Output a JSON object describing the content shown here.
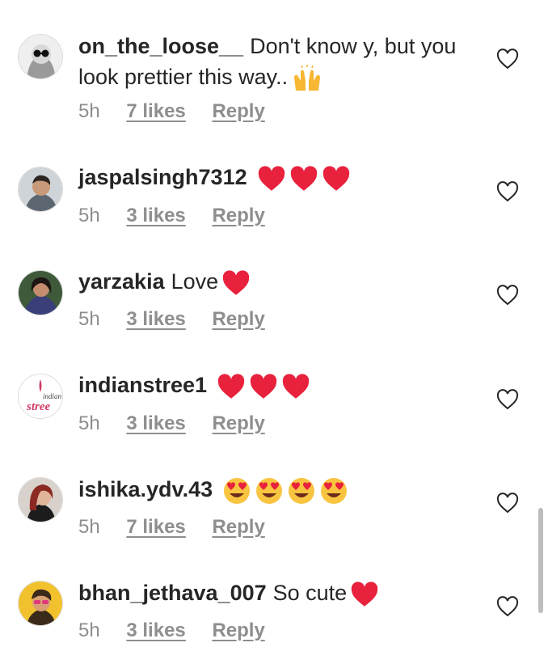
{
  "comments": [
    {
      "username": "on_the_loose__",
      "text": "Don't know y, but you look prettier this way..",
      "emojis": [
        "raising-hands"
      ],
      "time": "5h",
      "likes": "7 likes",
      "reply": "Reply"
    },
    {
      "username": "jaspalsingh7312",
      "text": "",
      "emojis": [
        "red-heart",
        "red-heart",
        "red-heart"
      ],
      "time": "5h",
      "likes": "3 likes",
      "reply": "Reply"
    },
    {
      "username": "yarzakia",
      "text": "Love",
      "emojis": [
        "red-heart"
      ],
      "time": "5h",
      "likes": "3 likes",
      "reply": "Reply"
    },
    {
      "username": "indianstree1",
      "text": "",
      "emojis": [
        "red-heart",
        "red-heart",
        "red-heart"
      ],
      "time": "5h",
      "likes": "3 likes",
      "reply": "Reply",
      "avatar_text": "indian stree"
    },
    {
      "username": "ishika.ydv.43",
      "text": "",
      "emojis": [
        "heart-eyes",
        "heart-eyes",
        "heart-eyes",
        "heart-eyes"
      ],
      "time": "5h",
      "likes": "7 likes",
      "reply": "Reply"
    },
    {
      "username": "bhan_jethava_007",
      "text": "So cute",
      "emojis": [
        "red-heart"
      ],
      "time": "5h",
      "likes": "3 likes",
      "reply": "Reply"
    }
  ],
  "colors": {
    "text": "#262626",
    "meta": "#8e8e8e",
    "heart": "#e8213d"
  }
}
